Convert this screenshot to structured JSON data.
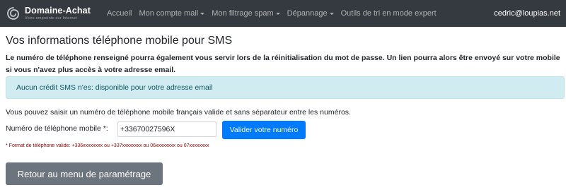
{
  "navbar": {
    "brand_name": "Domaine-Achat",
    "brand_tagline": "Votre empreinte sur Internet",
    "logo_icon": "spiral-logo-icon",
    "items": [
      {
        "label": "Accueil",
        "dropdown": false
      },
      {
        "label": "Mon compte mail",
        "dropdown": true
      },
      {
        "label": "Mon filtrage spam",
        "dropdown": true
      },
      {
        "label": "Dépannage",
        "dropdown": true
      },
      {
        "label": "Outils de tri en mode expert",
        "dropdown": false
      }
    ],
    "user_email": "cedric@loupias.net",
    "background_color": "#343a40"
  },
  "page": {
    "title": "Vos informations téléphone mobile pour SMS",
    "intro": "Le numéro de téléphone renseigné pourra également vous servir lors de la réinitialisation du mot de passe. Un lien pourra alors être envoyé sur votre mobile si vous n'avez plus accès à votre adresse email.",
    "alert": "Aucun crédit SMS n'es: disponible pour votre adresse email",
    "help_text": "Vous pouvez saisir un numéro de téléphone mobile français valide et sans séparateur entre les numéros.",
    "phone_label": "Numéro de téléphone mobile *:",
    "phone_value": "+33670027596X",
    "submit_label": "Valider votre numéro",
    "format_note": "* Format de téléphone valide: +336xxxxxxxx ou +337xxxxxxxx ou 06xxxxxxxx ou 07xxxxxxxx",
    "back_label": "Retour au menu de paramétrage"
  },
  "colors": {
    "primary": "#007bff",
    "secondary": "#6c757d",
    "info_bg": "#d1ecf1",
    "info_text": "#0c5460",
    "error_text": "#8b0000"
  }
}
